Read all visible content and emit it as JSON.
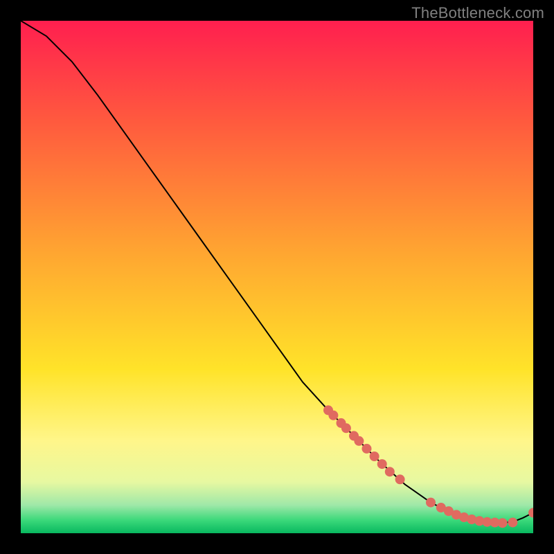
{
  "watermark": "TheBottleneck.com",
  "chart_data": {
    "type": "line",
    "title": "",
    "xlabel": "",
    "ylabel": "",
    "xlim": [
      0,
      100
    ],
    "ylim": [
      0,
      100
    ],
    "gradient_stops": [
      {
        "offset": 0.0,
        "color": "#ff1f4f"
      },
      {
        "offset": 0.2,
        "color": "#ff5b3e"
      },
      {
        "offset": 0.45,
        "color": "#ffa531"
      },
      {
        "offset": 0.68,
        "color": "#ffe329"
      },
      {
        "offset": 0.82,
        "color": "#fff68a"
      },
      {
        "offset": 0.9,
        "color": "#e7f8a1"
      },
      {
        "offset": 0.945,
        "color": "#9fe8a8"
      },
      {
        "offset": 0.975,
        "color": "#3ad87a"
      },
      {
        "offset": 1.0,
        "color": "#08b85f"
      }
    ],
    "series": [
      {
        "name": "curve",
        "type": "line",
        "x": [
          0,
          5,
          10,
          15,
          20,
          25,
          30,
          35,
          40,
          45,
          50,
          55,
          60,
          65,
          70,
          75,
          80,
          82,
          85,
          88,
          90,
          93,
          96,
          98,
          100
        ],
        "y": [
          100,
          97,
          92,
          85.5,
          78.5,
          71.5,
          64.5,
          57.5,
          50.5,
          43.5,
          36.5,
          29.5,
          24,
          19,
          14,
          9.5,
          6,
          5,
          3.5,
          2.5,
          2,
          2,
          2.2,
          3,
          4
        ],
        "stroke": "#000000",
        "stroke_width": 2
      },
      {
        "name": "markers",
        "type": "scatter",
        "x": [
          60,
          61,
          62.5,
          63.5,
          65,
          66,
          67.5,
          69,
          70.5,
          72,
          74,
          80,
          82,
          83.5,
          85,
          86.5,
          88,
          89.5,
          91,
          92.5,
          94,
          96,
          100
        ],
        "y": [
          24,
          23,
          21.5,
          20.5,
          19,
          18,
          16.5,
          15,
          13.5,
          12,
          10.5,
          6,
          5,
          4.3,
          3.6,
          3.1,
          2.7,
          2.4,
          2.2,
          2.1,
          2,
          2.1,
          4
        ],
        "marker_color": "#e06a60",
        "marker_radius": 7
      }
    ]
  }
}
